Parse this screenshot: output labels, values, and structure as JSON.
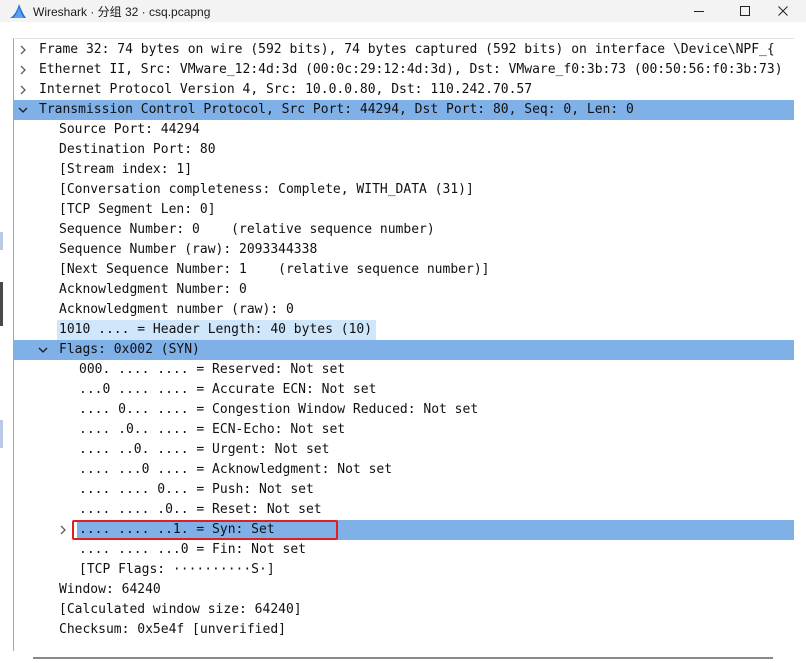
{
  "window": {
    "title": "Wireshark · 分组 32 · csq.pcapng",
    "icons": {
      "app": "wireshark-fin-icon",
      "minimize": "minimize-icon",
      "maximize": "maximize-icon",
      "close": "close-icon"
    }
  },
  "accent_colors": {
    "selected_row": "#7fb0e8",
    "related_row": "#cfe6fb",
    "highlight_box": "#e02020"
  },
  "tree": {
    "rows": [
      {
        "text": "Frame 32: 74 bytes on wire (592 bits), 74 bytes captured (592 bits) on interface \\Device\\NPF_{",
        "expander": "collapsed",
        "level": 0,
        "state": "normal"
      },
      {
        "text": "Ethernet II, Src: VMware_12:4d:3d (00:0c:29:12:4d:3d), Dst: VMware_f0:3b:73 (00:50:56:f0:3b:73)",
        "expander": "collapsed",
        "level": 0,
        "state": "normal"
      },
      {
        "text": "Internet Protocol Version 4, Src: 10.0.0.80, Dst: 110.242.70.57",
        "expander": "collapsed",
        "level": 0,
        "state": "normal"
      },
      {
        "text": "Transmission Control Protocol, Src Port: 44294, Dst Port: 80, Seq: 0, Len: 0",
        "expander": "expanded",
        "level": 0,
        "state": "selected"
      },
      {
        "text": "Source Port: 44294",
        "expander": "none",
        "level": 1,
        "state": "normal"
      },
      {
        "text": "Destination Port: 80",
        "expander": "none",
        "level": 1,
        "state": "normal"
      },
      {
        "text": "[Stream index: 1]",
        "expander": "none",
        "level": 1,
        "state": "normal"
      },
      {
        "text": "[Conversation completeness: Complete, WITH_DATA (31)]",
        "expander": "none",
        "level": 1,
        "state": "normal"
      },
      {
        "text": "[TCP Segment Len: 0]",
        "expander": "none",
        "level": 1,
        "state": "normal"
      },
      {
        "text": "Sequence Number: 0    (relative sequence number)",
        "expander": "none",
        "level": 1,
        "state": "normal"
      },
      {
        "text": "Sequence Number (raw): 2093344338",
        "expander": "none",
        "level": 1,
        "state": "normal"
      },
      {
        "text": "[Next Sequence Number: 1    (relative sequence number)]",
        "expander": "none",
        "level": 1,
        "state": "normal"
      },
      {
        "text": "Acknowledgment Number: 0",
        "expander": "none",
        "level": 1,
        "state": "normal"
      },
      {
        "text": "Acknowledgment number (raw): 0",
        "expander": "none",
        "level": 1,
        "state": "normal"
      },
      {
        "text": "1010 .... = Header Length: 40 bytes (10)",
        "expander": "none",
        "level": 1,
        "state": "light"
      },
      {
        "text": "Flags: 0x002 (SYN)",
        "expander": "expanded",
        "level": 1,
        "state": "selected"
      },
      {
        "text": "000. .... .... = Reserved: Not set",
        "expander": "none",
        "level": 2,
        "state": "normal"
      },
      {
        "text": "...0 .... .... = Accurate ECN: Not set",
        "expander": "none",
        "level": 2,
        "state": "normal"
      },
      {
        "text": ".... 0... .... = Congestion Window Reduced: Not set",
        "expander": "none",
        "level": 2,
        "state": "normal"
      },
      {
        "text": ".... .0.. .... = ECN-Echo: Not set",
        "expander": "none",
        "level": 2,
        "state": "normal"
      },
      {
        "text": ".... ..0. .... = Urgent: Not set",
        "expander": "none",
        "level": 2,
        "state": "normal"
      },
      {
        "text": ".... ...0 .... = Acknowledgment: Not set",
        "expander": "none",
        "level": 2,
        "state": "normal"
      },
      {
        "text": ".... .... 0... = Push: Not set",
        "expander": "none",
        "level": 2,
        "state": "normal"
      },
      {
        "text": ".... .... .0.. = Reset: Not set",
        "expander": "none",
        "level": 2,
        "state": "normal"
      },
      {
        "text": ".... .... ..1. = Syn: Set",
        "expander": "collapsed",
        "level": 2,
        "state": "selected"
      },
      {
        "text": ".... .... ...0 = Fin: Not set",
        "expander": "none",
        "level": 2,
        "state": "normal"
      },
      {
        "text": "[TCP Flags: ··········S·]",
        "expander": "none",
        "level": 2,
        "state": "normal"
      },
      {
        "text": "Window: 64240",
        "expander": "none",
        "level": 1,
        "state": "normal"
      },
      {
        "text": "[Calculated window size: 64240]",
        "expander": "none",
        "level": 1,
        "state": "normal"
      },
      {
        "text": "Checksum: 0x5e4f [unverified]",
        "expander": "none",
        "level": 1,
        "state": "normal"
      }
    ]
  }
}
